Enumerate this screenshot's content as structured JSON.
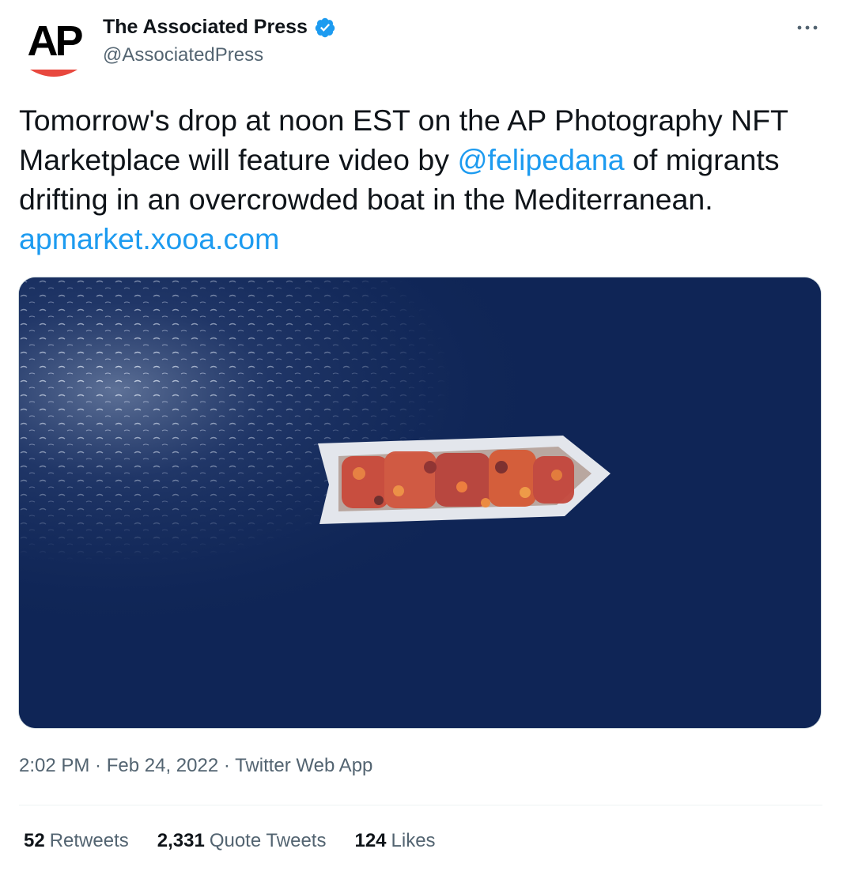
{
  "author": {
    "avatar_text": "AP",
    "display_name": "The Associated Press",
    "handle": "@AssociatedPress",
    "verified": true
  },
  "more_icon": "more-horizontal-icon",
  "tweet": {
    "text_part1": "Tomorrow's drop at noon EST on the AP Photography NFT Marketplace will feature video by ",
    "mention": "@felipedana",
    "text_part2": " of migrants drifting in an overcrowded boat in the Mediterranean. ",
    "link": "apmarket.xooa.com"
  },
  "meta": {
    "time": "2:02 PM",
    "separator1": " · ",
    "date": "Feb 24, 2022",
    "separator2": " · ",
    "source": "Twitter Web App"
  },
  "stats": {
    "retweets_count": "52",
    "retweets_label": "Retweets",
    "quotes_count": "2,331",
    "quotes_label": "Quote Tweets",
    "likes_count": "124",
    "likes_label": "Likes"
  },
  "colors": {
    "link": "#1d9bf0",
    "secondary_text": "#536471",
    "primary_text": "#0f1419",
    "ap_red": "#e8483e"
  }
}
